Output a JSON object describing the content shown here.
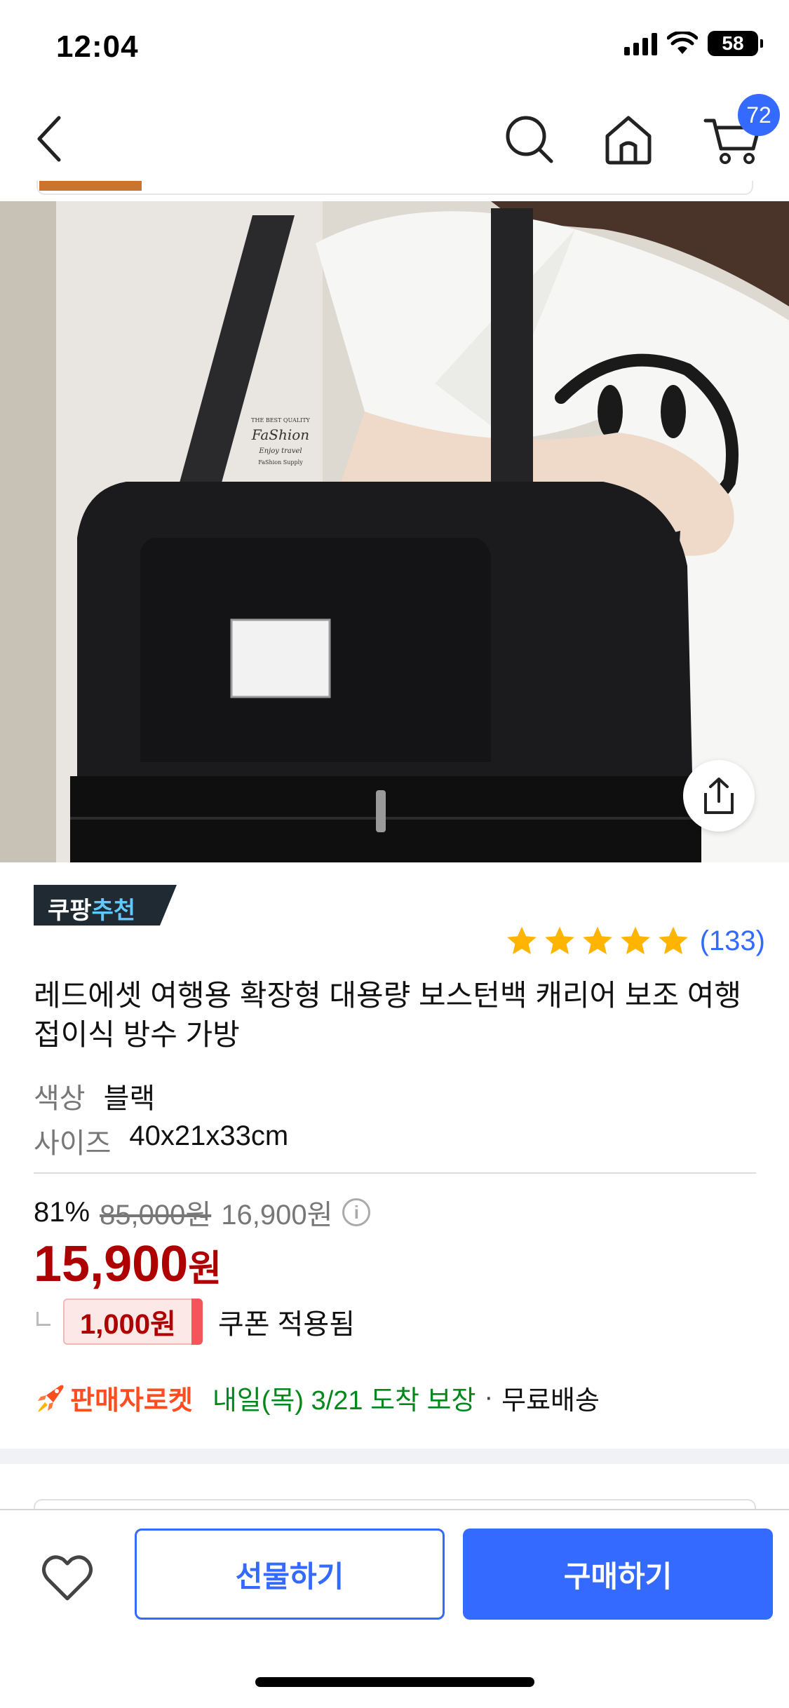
{
  "status_bar": {
    "time": "12:04",
    "battery": "58"
  },
  "nav": {
    "cart_count": "72"
  },
  "product": {
    "badge_main": "쿠팡",
    "badge_accent": "추천",
    "rating_stars": 5,
    "review_count": "(133)",
    "title": "레드에셋 여행용 확장형 대용량 보스턴백 캐리어 보조 여행 접이식 방수 가방",
    "options": [
      {
        "key": "색상",
        "value": "블랙"
      },
      {
        "key": "사이즈",
        "value": "40x21x33cm"
      }
    ],
    "image_label": {
      "line1": "THE BEST QUALITY",
      "line2": "FaShion",
      "line3": "Enjoy travel",
      "line4": "FaShion Supply"
    }
  },
  "price": {
    "discount_rate": "81%",
    "original": "85,000원",
    "sale": "16,900원",
    "info_glyph": "i",
    "final_amount": "15,900",
    "final_unit": "원",
    "coupon_amount": "1,000원",
    "coupon_note": "쿠폰 적용됨"
  },
  "delivery": {
    "brand": "판매자로켓",
    "arrival": "내일(목) 3/21 도착 보장",
    "separator": "·",
    "shipping": "무료배송"
  },
  "bottom_bar": {
    "gift_label": "선물하기",
    "buy_label": "구매하기"
  },
  "colors": {
    "accent": "#346aff",
    "price_red": "#ae0000",
    "star": "#ffb400",
    "delivery_green": "#00891a",
    "rocket_orange": "#ff4d1f"
  }
}
